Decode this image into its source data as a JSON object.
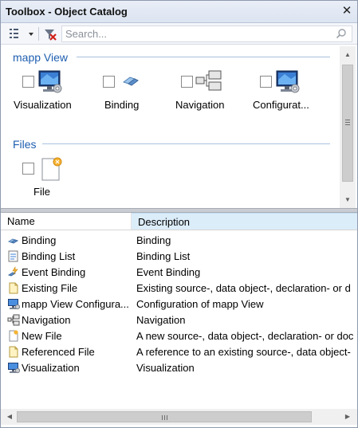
{
  "window": {
    "title": "Toolbox - Object Catalog",
    "close_glyph": "✕"
  },
  "toolbar": {
    "view_button_icon": "view-mode-icon",
    "dropdown_icon": "chevron-down-icon",
    "filter_button_icon": "clear-filter-icon",
    "search_placeholder": "Search...",
    "search_icon": "search-icon"
  },
  "catalog": {
    "groups": [
      {
        "title": "mapp View",
        "items": [
          {
            "label": "Visualization",
            "icon": "monitor-gear-icon"
          },
          {
            "label": "Binding",
            "icon": "binding-icon"
          },
          {
            "label": "Navigation",
            "icon": "navigation-icon"
          },
          {
            "label": "Configurat...",
            "icon": "monitor-gear-icon"
          }
        ]
      },
      {
        "title": "Files",
        "items": [
          {
            "label": "File",
            "icon": "new-file-icon"
          }
        ]
      }
    ]
  },
  "list": {
    "columns": {
      "name": "Name",
      "description": "Description"
    },
    "rows": [
      {
        "name": "Binding",
        "description": "Binding",
        "icon": "binding-icon"
      },
      {
        "name": "Binding List",
        "description": "Binding List",
        "icon": "binding-list-icon"
      },
      {
        "name": "Event Binding",
        "description": "Event Binding",
        "icon": "event-binding-icon"
      },
      {
        "name": "Existing File",
        "description": "Existing source-, data object-, declaration- or d",
        "icon": "file-icon"
      },
      {
        "name": "mapp View Configura...",
        "description": "Configuration of mapp View",
        "icon": "monitor-gear-icon"
      },
      {
        "name": "Navigation",
        "description": "Navigation",
        "icon": "navigation-icon"
      },
      {
        "name": "New File",
        "description": "A new source-, data object-, declaration- or doc",
        "icon": "new-file-icon"
      },
      {
        "name": "Referenced File",
        "description": "A reference to an existing source-, data object-",
        "icon": "file-icon"
      },
      {
        "name": "Visualization",
        "description": "Visualization",
        "icon": "monitor-gear-icon"
      }
    ]
  },
  "colors": {
    "group_title": "#1f5fb0",
    "selected_column": "#dcedfa",
    "title_bar": "#dce4f1"
  }
}
